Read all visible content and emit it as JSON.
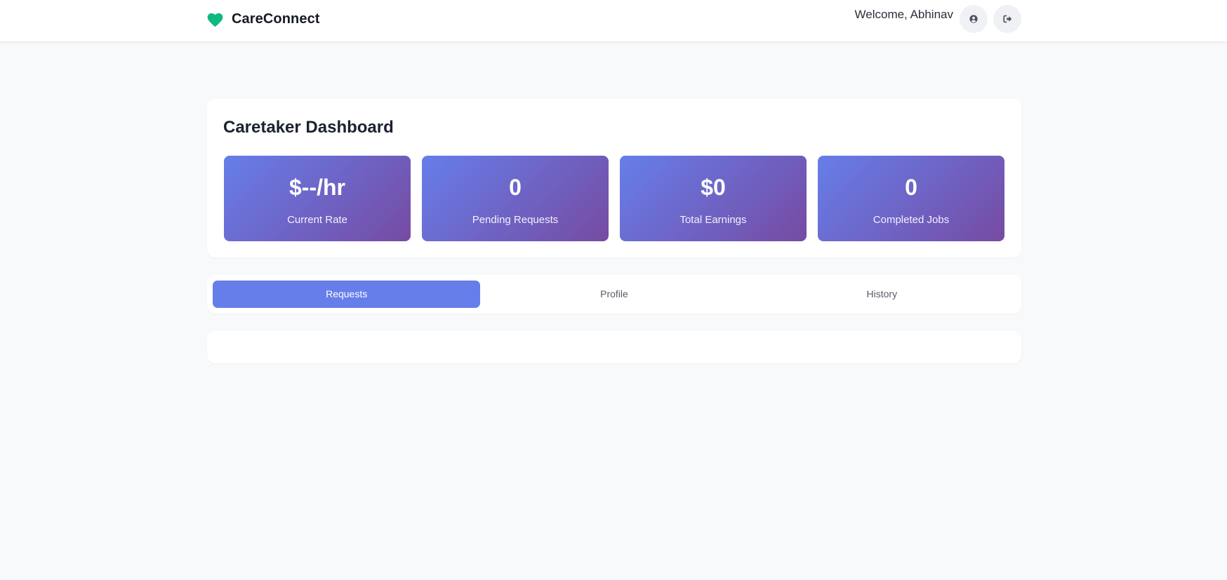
{
  "header": {
    "brand": "CareConnect",
    "brand_icon": "heart-icon",
    "brand_color": "#10b981",
    "welcome": "Welcome, Abhinav",
    "profile_icon": "user-circle-icon",
    "logout_icon": "sign-out-icon"
  },
  "dashboard": {
    "title": "Caretaker Dashboard",
    "accent_gradient": [
      "#667eea",
      "#764ba2"
    ],
    "stats": [
      {
        "value": "$--/hr",
        "label": "Current Rate"
      },
      {
        "value": "0",
        "label": "Pending Requests"
      },
      {
        "value": "$0",
        "label": "Total Earnings"
      },
      {
        "value": "0",
        "label": "Completed Jobs"
      }
    ]
  },
  "tabs": {
    "items": [
      {
        "label": "Requests"
      },
      {
        "label": "Profile"
      },
      {
        "label": "History"
      }
    ],
    "active": "Requests",
    "active_color": "#667eea"
  }
}
